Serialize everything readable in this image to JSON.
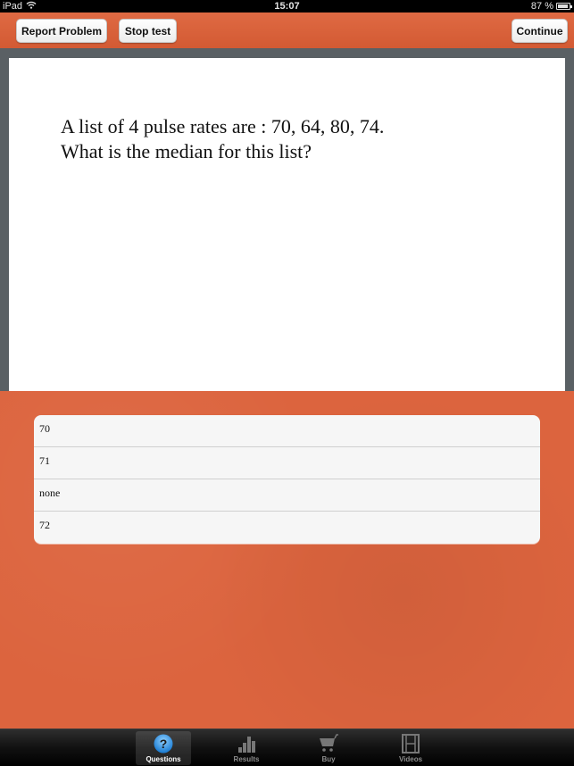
{
  "status_bar": {
    "device": "iPad",
    "time": "15:07",
    "battery": "87 %",
    "battery_level": 0.87
  },
  "toolbar": {
    "report_label": "Report Problem",
    "stop_label": "Stop test",
    "continue_label": "Continue"
  },
  "question": {
    "line1": "A list of 4 pulse rates are : 70, 64, 80, 74.",
    "line2": "What is the median for this list?"
  },
  "answers": [
    {
      "label": "70"
    },
    {
      "label": "71"
    },
    {
      "label": "none"
    },
    {
      "label": "72"
    }
  ],
  "tabs": [
    {
      "label": "Questions",
      "icon": "question-icon",
      "active": true
    },
    {
      "label": "Results",
      "icon": "bar-chart-icon",
      "active": false
    },
    {
      "label": "Buy",
      "icon": "cart-icon",
      "active": false
    },
    {
      "label": "Videos",
      "icon": "film-icon",
      "active": false
    }
  ],
  "colors": {
    "accent": "#dc643e",
    "question_icon": "#3a9be0"
  }
}
